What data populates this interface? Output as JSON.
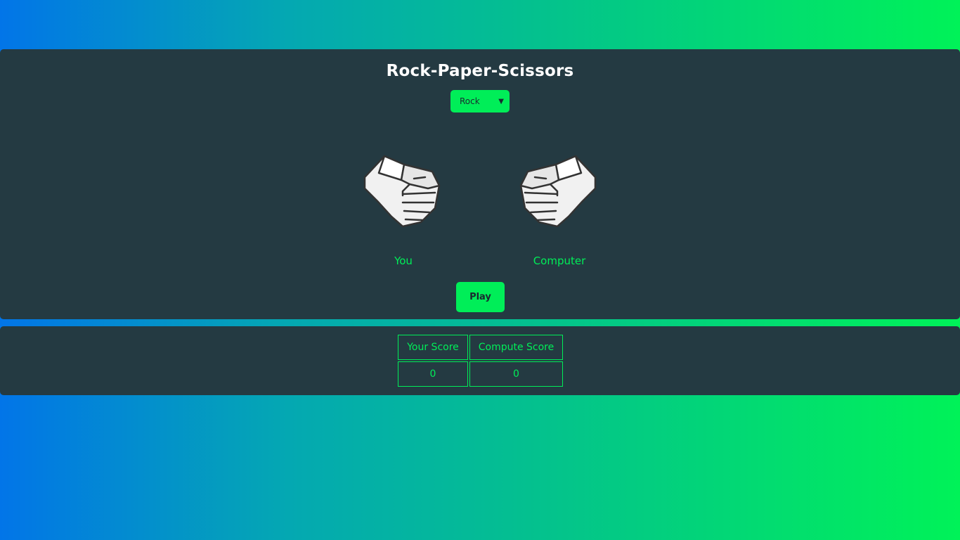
{
  "game": {
    "title": "Rock-Paper-Scissors",
    "selected_choice": "Rock",
    "player_label": "You",
    "computer_label": "Computer",
    "play_label": "Play",
    "player_hand": "rock-fist-icon",
    "computer_hand": "rock-fist-icon"
  },
  "scoreboard": {
    "headers": [
      "Your Score",
      "Compute Score"
    ],
    "values": [
      "0",
      "0"
    ]
  },
  "colors": {
    "accent": "#00ee58",
    "panel": "#243a42",
    "gradient_start": "#0275e8",
    "gradient_end": "#00f258"
  }
}
